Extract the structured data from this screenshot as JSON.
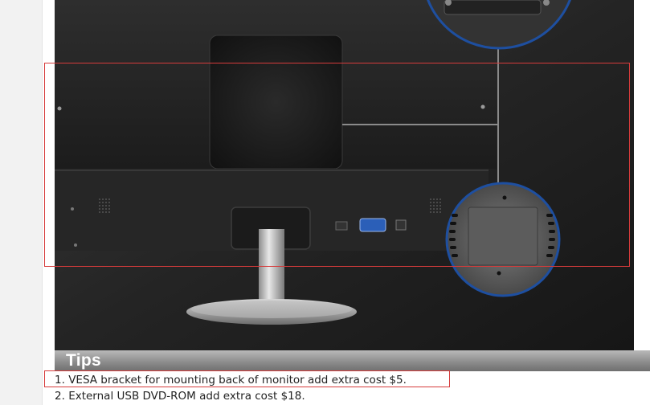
{
  "product_photo": {
    "alt": "Monitor rear view with VESA mount and ports"
  },
  "tips": {
    "title": "Tips",
    "items": [
      {
        "number": "1.",
        "text": "VESA bracket for mounting back of monitor add extra cost $5."
      },
      {
        "number": "2.",
        "text": "External USB DVD-ROM add extra cost $18."
      }
    ]
  },
  "colors": {
    "highlight": "#d63b3b",
    "tips_bar": "#8d8d8d",
    "zoom_ring": "#1e4fa0"
  }
}
